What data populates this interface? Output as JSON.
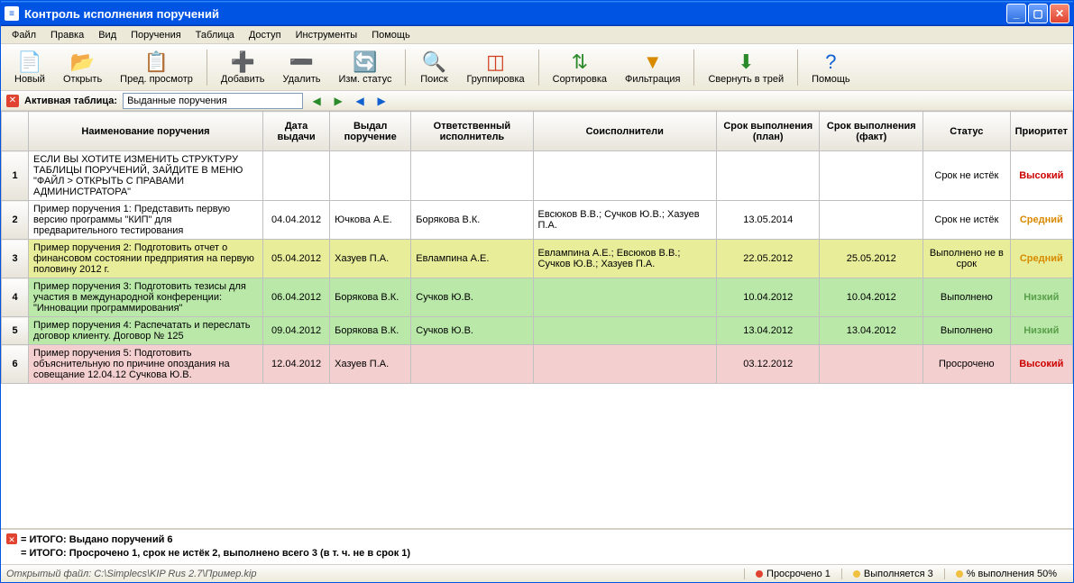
{
  "title": "Контроль исполнения поручений",
  "menu": [
    "Файл",
    "Правка",
    "Вид",
    "Поручения",
    "Таблица",
    "Доступ",
    "Инструменты",
    "Помощь"
  ],
  "toolbar": [
    {
      "id": "new",
      "label": "Новый",
      "icon": "📄"
    },
    {
      "id": "open",
      "label": "Открыть",
      "icon": "📂"
    },
    {
      "id": "preview",
      "label": "Пред. просмотр",
      "icon": "📋"
    },
    {
      "sep": true
    },
    {
      "id": "add",
      "label": "Добавить",
      "icon": "➕",
      "color": "#2a8a2a"
    },
    {
      "id": "delete",
      "label": "Удалить",
      "icon": "➖",
      "color": "#d04020"
    },
    {
      "id": "status",
      "label": "Изм. статус",
      "icon": "🔄",
      "color": "#2a8a2a"
    },
    {
      "sep": true
    },
    {
      "id": "search",
      "label": "Поиск",
      "icon": "🔍"
    },
    {
      "id": "group",
      "label": "Группировка",
      "icon": "◫",
      "color": "#d04020"
    },
    {
      "sep": true
    },
    {
      "id": "sort",
      "label": "Сортировка",
      "icon": "⇅",
      "color": "#2a8a2a"
    },
    {
      "id": "filter",
      "label": "Фильтрация",
      "icon": "▼",
      "color": "#d88a00"
    },
    {
      "sep": true
    },
    {
      "id": "tray",
      "label": "Свернуть в трей",
      "icon": "⬇",
      "color": "#2a8a2a"
    },
    {
      "sep": true
    },
    {
      "id": "help",
      "label": "Помощь",
      "icon": "?",
      "color": "#1060d0"
    }
  ],
  "subbar": {
    "label": "Активная таблица:",
    "value": "Выданные поручения"
  },
  "columns": [
    "",
    "Наименование поручения",
    "Дата выдачи",
    "Выдал поручение",
    "Ответственный исполнитель",
    "Соисполнители",
    "Срок выполнения (план)",
    "Срок выполнения (факт)",
    "Статус",
    "Приоритет"
  ],
  "rows": [
    {
      "n": "1",
      "cls": "",
      "name": "ЕСЛИ ВЫ ХОТИТЕ ИЗМЕНИТЬ СТРУКТУРУ ТАБЛИЦЫ ПОРУЧЕНИЙ, ЗАЙДИТЕ В МЕНЮ \"ФАЙЛ > ОТКРЫТЬ С ПРАВАМИ АДМИНИСТРАТОРА\"",
      "date": "",
      "issuer": "",
      "resp": "",
      "co": "",
      "plan": "",
      "fact": "",
      "status": "Срок не истёк",
      "prio": "Высокий",
      "prioCls": "prio-high"
    },
    {
      "n": "2",
      "cls": "",
      "name": "Пример поручения 1: Представить первую версию программы \"КИП\" для предварительного тестирования",
      "date": "04.04.2012",
      "issuer": "Ючкова А.Е.",
      "resp": "Борякова В.К.",
      "co": "Евсюков В.В.; Сучков Ю.В.; Хазуев П.А.",
      "plan": "13.05.2014",
      "fact": "",
      "status": "Срок не истёк",
      "prio": "Средний",
      "prioCls": "prio-med"
    },
    {
      "n": "3",
      "cls": "ryellow",
      "name": "Пример поручения 2: Подготовить отчет о финансовом состоянии предприятия на первую половину 2012 г.",
      "date": "05.04.2012",
      "issuer": "Хазуев П.А.",
      "resp": "Евлампина А.Е.",
      "co": "Евлампина А.Е.; Евсюков В.В.; Сучков Ю.В.; Хазуев П.А.",
      "plan": "22.05.2012",
      "fact": "25.05.2012",
      "status": "Выполнено не в срок",
      "prio": "Средний",
      "prioCls": "prio-med"
    },
    {
      "n": "4",
      "cls": "rgreen",
      "name": "Пример поручения 3: Подготовить тезисы для участия в международной конференции: \"Инновации программирования\"",
      "date": "06.04.2012",
      "issuer": "Борякова В.К.",
      "resp": "Сучков Ю.В.",
      "co": "",
      "plan": "10.04.2012",
      "fact": "10.04.2012",
      "status": "Выполнено",
      "prio": "Низкий",
      "prioCls": "prio-low"
    },
    {
      "n": "5",
      "cls": "rgreen",
      "name": "Пример поручения 4: Распечатать и переслать договор клиенту. Договор № 125",
      "date": "09.04.2012",
      "issuer": "Борякова В.К.",
      "resp": "Сучков Ю.В.",
      "co": "",
      "plan": "13.04.2012",
      "fact": "13.04.2012",
      "status": "Выполнено",
      "prio": "Низкий",
      "prioCls": "prio-low"
    },
    {
      "n": "6",
      "cls": "rpink",
      "name": "Пример поручения 5: Подготовить объяснительную по причине опоздания на совещание 12.04.12 Сучкова Ю.В.",
      "date": "12.04.2012",
      "issuer": "Хазуев П.А.",
      "resp": "",
      "co": "",
      "plan": "03.12.2012",
      "fact": "",
      "status": "Просрочено",
      "prio": "Высокий",
      "prioCls": "prio-high"
    }
  ],
  "summary": {
    "l1": "= ИТОГО: Выдано поручений 6",
    "l2": "= ИТОГО: Просрочено 1, срок не истёк 2, выполнено всего 3 (в т. ч. не в срок 1)"
  },
  "status": {
    "file": "Открытый файл: C:\\Simplecs\\KIP Rus 2.7\\Пример.kip",
    "s1": "Просрочено 1",
    "s2": "Выполняется 3",
    "s3": "% выполнения 50%"
  }
}
